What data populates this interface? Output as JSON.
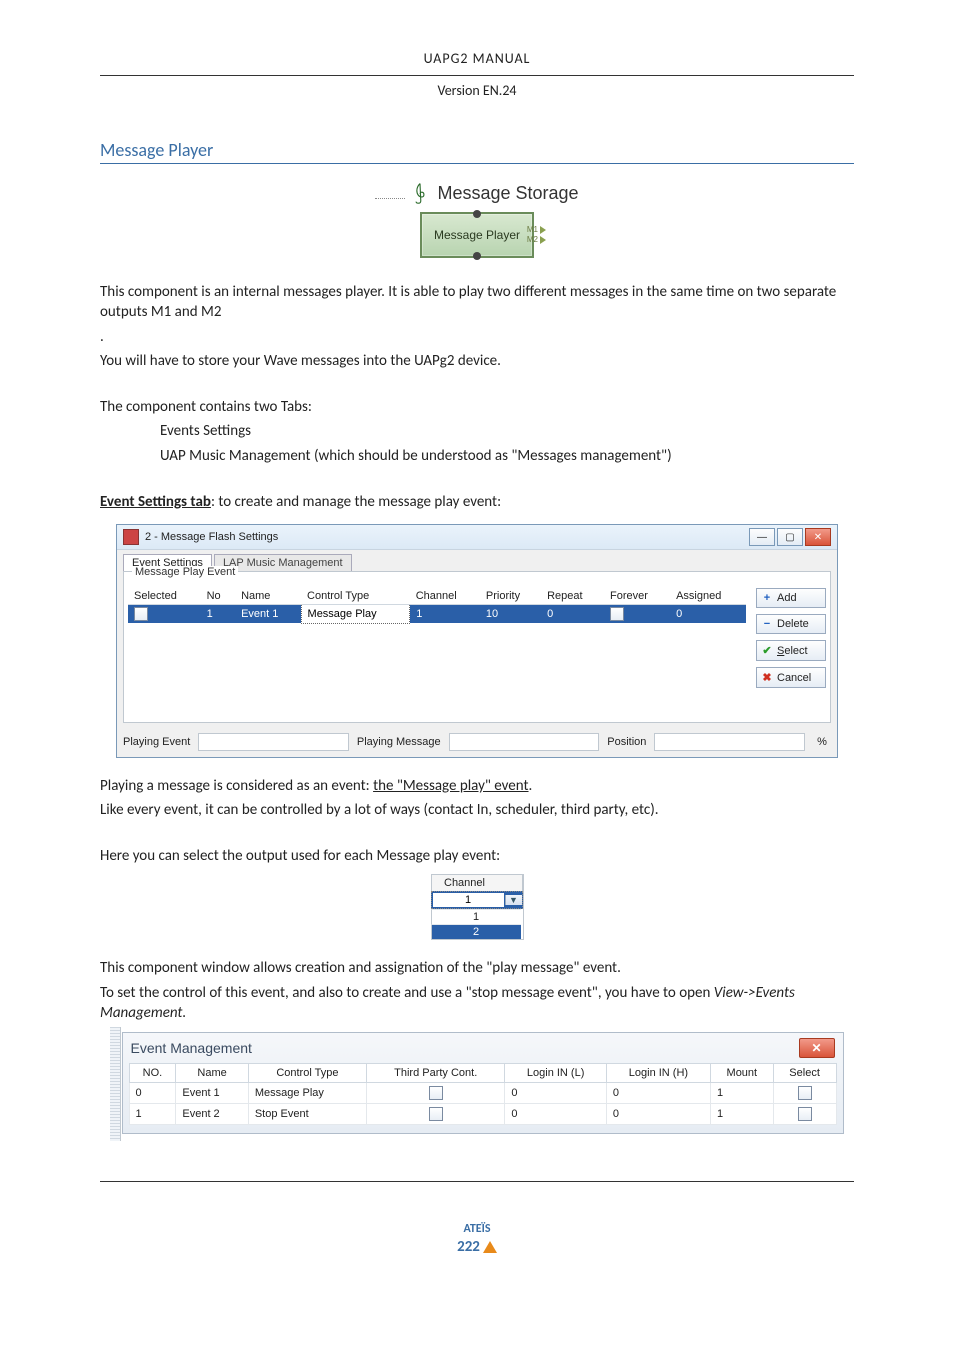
{
  "header": {
    "title": "UAPG2  MANUAL",
    "subtitle": "Version EN.24"
  },
  "section_title": "Message Player",
  "tree_item_label": "Message Storage",
  "component_label": "Message Player",
  "component_pins": {
    "m1": "M1",
    "m2": "M2"
  },
  "p1": "This component is an internal messages player. It is able to play two different messages in the same time on two separate outputs M1 and M2",
  "p1_dot": ".",
  "p2": "You will have to store your Wave messages into the UAPg2 device.",
  "p3": "The component contains two Tabs:",
  "tabs_list": {
    "a": "Events Settings",
    "b": "UAP Music Management (which should be understood as \"Messages management\")"
  },
  "est_label": "Event Settings tab",
  "est_rest": ": to create and manage the message play event:",
  "dialog": {
    "title": "2 - Message Flash Settings",
    "tab1": "Event Settings",
    "tab2": "LAP Music Management",
    "group": "Message Play Event",
    "cols": {
      "selected": "Selected",
      "no": "No",
      "name": "Name",
      "ctype": "Control Type",
      "channel": "Channel",
      "priority": "Priority",
      "repeat": "Repeat",
      "forever": "Forever",
      "assigned": "Assigned"
    },
    "row": {
      "no": "1",
      "name": "Event 1",
      "ctype": "Message Play",
      "channel": "1",
      "priority": "10",
      "repeat": "0",
      "assigned": "0"
    },
    "btns": {
      "add": "Add",
      "delete": "Delete",
      "select": "elect",
      "select_u": "S",
      "cancel": "Cancel"
    },
    "status": {
      "playing_event": "Playing Event",
      "playing_message": "Playing Message",
      "position": "Position",
      "pct": "%"
    }
  },
  "p4a": "Playing a message is considered as an event: ",
  "p4b": "the \"Message play\" event",
  "p4c": ".",
  "p5": "Like every event, it can be controlled by a lot of ways (contact In, scheduler, third party, etc).",
  "p6": "Here you can select the output used for each Message play event:",
  "channel_dd": {
    "header": "Channel",
    "current": "1",
    "opt1": "1",
    "opt2": "2"
  },
  "p7": "This component window allows creation and assignation of the \"play message\" event.",
  "p8": "To set the control of this event, and also to create and use a \"stop message event\", you have to open ",
  "p8_em": "View->Events Management.",
  "em": {
    "title": "Event Management",
    "cols": {
      "no": "NO.",
      "name": "Name",
      "ctype": "Control Type",
      "tpc": "Third Party Cont.",
      "linl": "Login IN (L)",
      "linh": "Login IN (H)",
      "mount": "Mount",
      "select": "Select"
    },
    "rows": [
      {
        "no": "0",
        "name": "Event 1",
        "ctype": "Message Play",
        "linl": "0",
        "linh": "0",
        "mount": "1"
      },
      {
        "no": "1",
        "name": "Event 2",
        "ctype": "Stop Event",
        "linl": "0",
        "linh": "0",
        "mount": "1"
      }
    ]
  },
  "footer": {
    "brand": "ATEÏS",
    "page": "222"
  }
}
